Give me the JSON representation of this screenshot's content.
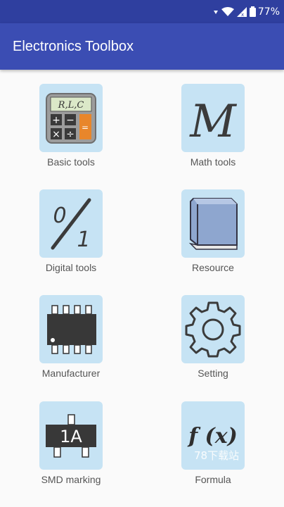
{
  "status_bar": {
    "battery": "77%"
  },
  "app_bar": {
    "title": "Electronics Toolbox"
  },
  "tiles": [
    {
      "label": "Basic tools",
      "icon": "calculator-icon",
      "icon_text": "R,L,C"
    },
    {
      "label": "Math tools",
      "icon": "math-m-icon",
      "icon_text": "M"
    },
    {
      "label": "Digital tools",
      "icon": "digital-zero-one-icon",
      "icon_text_top": "0",
      "icon_text_bottom": "1"
    },
    {
      "label": "Resource",
      "icon": "book-icon"
    },
    {
      "label": "Manufacturer",
      "icon": "chip-icon"
    },
    {
      "label": "Setting",
      "icon": "gear-icon"
    },
    {
      "label": "SMD marking",
      "icon": "smd-component-icon",
      "icon_text": "1A"
    },
    {
      "label": "Formula",
      "icon": "formula-icon",
      "icon_text": "f (x)"
    }
  ],
  "watermark": "78下载站",
  "colors": {
    "status_bar": "#2f3f9f",
    "app_bar": "#3b4db3",
    "tile_bg": "#c6e3f4",
    "label": "#555555"
  }
}
